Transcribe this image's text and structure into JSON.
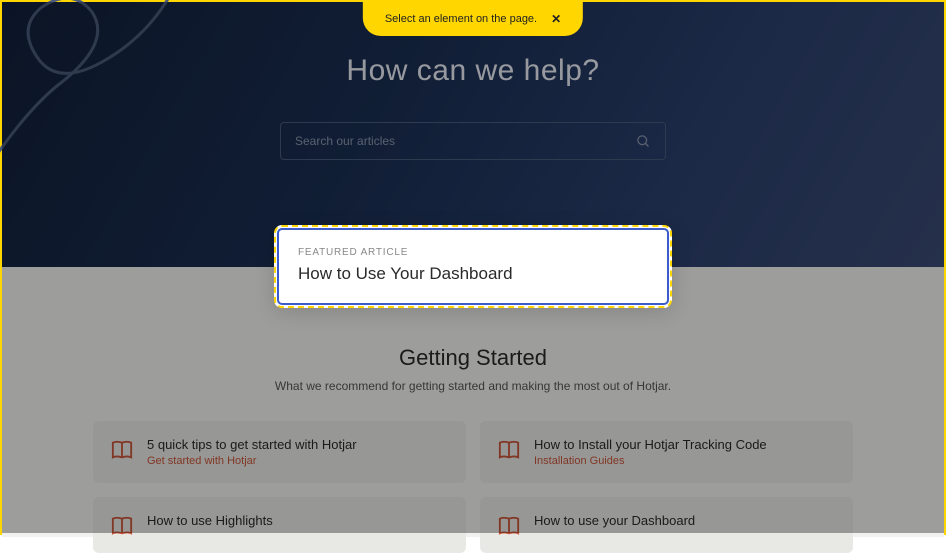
{
  "banner": {
    "text": "Select an element on the page.",
    "close": "✕"
  },
  "hero": {
    "title": "How can we help?",
    "search_placeholder": "Search our articles"
  },
  "featured": {
    "label": "FEATURED ARTICLE",
    "title": "How to Use Your Dashboard"
  },
  "section": {
    "title": "Getting Started",
    "subtitle": "What we recommend for getting started and making the most out of Hotjar."
  },
  "cards": [
    {
      "title": "5 quick tips to get started with Hotjar",
      "sub": "Get started with Hotjar"
    },
    {
      "title": "How to Install your Hotjar Tracking Code",
      "sub": "Installation Guides"
    },
    {
      "title": "How to use Highlights",
      "sub": ""
    },
    {
      "title": "How to use your Dashboard",
      "sub": ""
    }
  ]
}
